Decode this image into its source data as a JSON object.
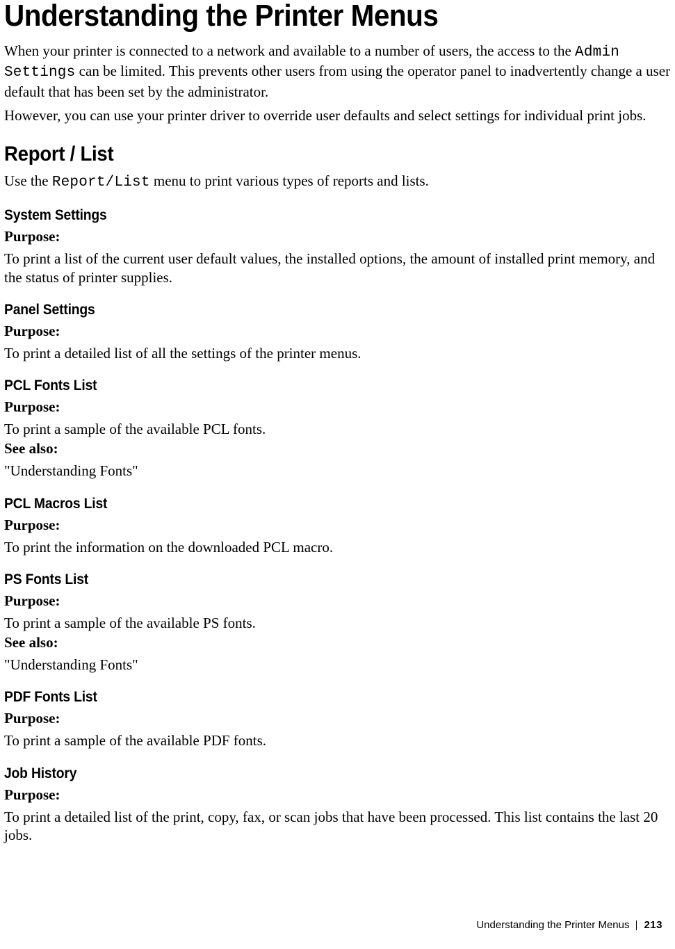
{
  "page_title": "Understanding the Printer Menus",
  "intro": {
    "p1_pre": "When your printer is connected to a network and available to a number of users, the access to the ",
    "p1_code": "Admin Settings",
    "p1_post": " can be limited. This prevents other users from using the operator panel to inadvertently change a user default that has been set by the administrator.",
    "p2": "However, you can use your printer driver to override user defaults and select settings for individual print jobs."
  },
  "report_list": {
    "heading": "Report / List",
    "sentence_pre": "Use the ",
    "sentence_code": "Report/List",
    "sentence_post": " menu to print various types of reports and lists."
  },
  "items": {
    "system_settings": {
      "heading": "System Settings",
      "purpose_label": "Purpose:",
      "purpose_text": "To print a list of the current user default values, the installed options, the amount of installed print memory, and the status of printer supplies."
    },
    "panel_settings": {
      "heading": "Panel Settings",
      "purpose_label": "Purpose:",
      "purpose_text": "To print a detailed list of all the settings of the printer menus."
    },
    "pcl_fonts_list": {
      "heading": "PCL Fonts List",
      "purpose_label": "Purpose:",
      "purpose_text": "To print a sample of the available PCL fonts.",
      "see_also_label": "See also:",
      "see_also_text": "\"Understanding Fonts\""
    },
    "pcl_macros_list": {
      "heading": "PCL Macros List",
      "purpose_label": "Purpose:",
      "purpose_text": "To print the information on the downloaded PCL macro."
    },
    "ps_fonts_list": {
      "heading": "PS Fonts List",
      "purpose_label": "Purpose:",
      "purpose_text": "To print a sample of the available PS fonts.",
      "see_also_label": "See also:",
      "see_also_text": "\"Understanding Fonts\""
    },
    "pdf_fonts_list": {
      "heading": "PDF Fonts List",
      "purpose_label": "Purpose:",
      "purpose_text": "To print a sample of the available PDF fonts."
    },
    "job_history": {
      "heading": "Job History",
      "purpose_label": "Purpose:",
      "purpose_text": "To print a detailed list of the print, copy, fax, or scan jobs that have been processed. This list contains the last 20 jobs."
    }
  },
  "footer": {
    "title": "Understanding the Printer Menus",
    "page_number": "213"
  }
}
